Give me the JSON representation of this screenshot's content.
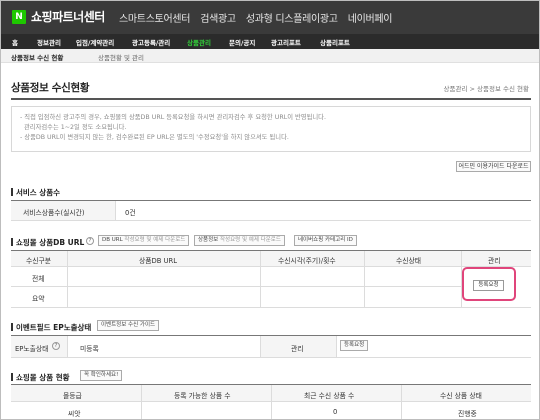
{
  "header": {
    "logo_letter": "N",
    "brand": "쇼핑파트너센터",
    "links": [
      "스마트스토어센터",
      "검색광고",
      "성과형 디스플레이광고",
      "네이버페이"
    ]
  },
  "nav": {
    "items": [
      "홈",
      "정보관리",
      "입점/계약관리",
      "광고등록/관리",
      "상품관리",
      "문의/공지",
      "광고리포트",
      "상품리포트"
    ],
    "active_index": 4
  },
  "subnav": {
    "current": "상품정보 수신 현황",
    "other": "상품현황 및 관리"
  },
  "page": {
    "title": "상품정보 수신현황",
    "breadcrumb": "상품관리 > 상품정보 수신 현황"
  },
  "notice": {
    "lines": [
      "- 직접 입점하신 광고주의 경우, 쇼핑몰의 상품DB URL 등록요청을 하시면 관리자검수 후 요청한 URL이 반영됩니다.",
      "  관리자검수는 1~2일 정도 소요됩니다.",
      "- 상품DB URL이 변경되지 않는 한, 검수완료된 EP URL은 별도의 '수정요청'을 하지 않으셔도 됩니다."
    ]
  },
  "guide_button": "어드민 이용가이드 다운로드",
  "service_count": {
    "title": "서비스 상품수",
    "label": "서비스상품수(실시간)",
    "value": "0건"
  },
  "db_url": {
    "title": "쇼핑몰 상품DB URL",
    "help": "?",
    "buttons": [
      {
        "label": "DB URL ",
        "sub": "작성요령 및 예제 다운로드"
      },
      {
        "label": "상품정보 ",
        "sub": "작성요령 및 예제 다운로드"
      },
      {
        "label": "네이버쇼핑 카테고리 ID",
        "sub": ""
      }
    ],
    "columns": [
      "수신구분",
      "상품DB URL",
      "수신시각(주기)/횟수",
      "수신상태",
      "관리"
    ],
    "rows": [
      {
        "type": "전체",
        "url": "",
        "time": "",
        "status": ""
      },
      {
        "type": "요약",
        "url": "",
        "time": "",
        "status": ""
      }
    ],
    "register_button": "등록요청"
  },
  "event_ep": {
    "title": "이벤트필드 EP노출상태",
    "guide_button": "이벤트정보 수신 가이드",
    "status_label": "EP노출상태",
    "help": "?",
    "status_value": "미등록",
    "manage_label": "관리",
    "register_button": "등록요청"
  },
  "product_status": {
    "title": "쇼핑몰 상품 현황",
    "check_button": "꼭 확인하세요!",
    "columns": [
      "몰등급",
      "등록 가능한 상품 수",
      "최근 수신 상품 수",
      "수신 상품 상태"
    ],
    "rows": [
      {
        "grade": "씨앗",
        "possible": "",
        "recent": "0",
        "state": "진행중"
      }
    ]
  }
}
